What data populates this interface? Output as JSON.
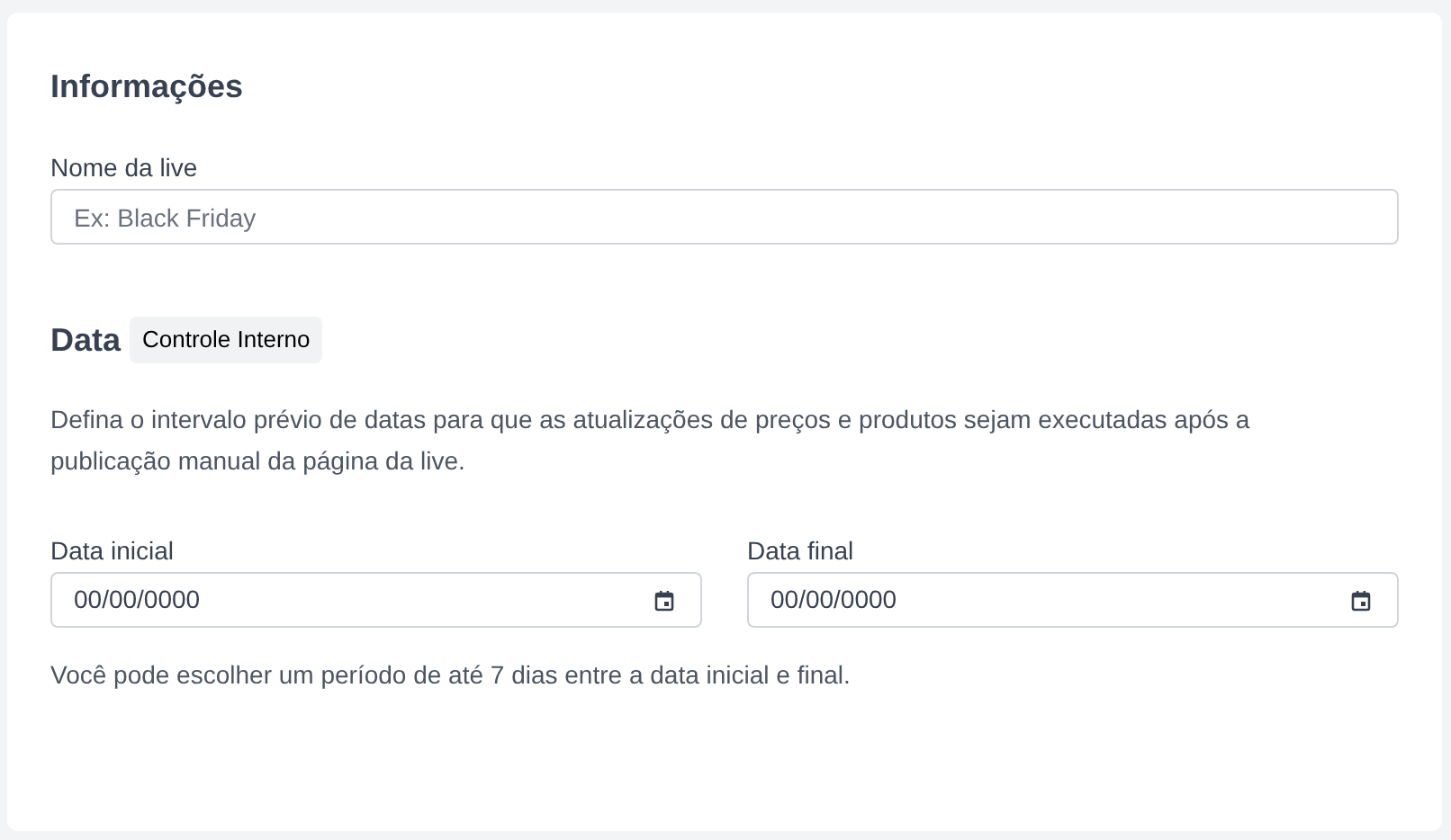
{
  "section_title": "Informações",
  "name_field": {
    "label": "Nome da live",
    "placeholder": "Ex: Black Friday"
  },
  "date_section": {
    "title": "Data",
    "badge": "Controle Interno",
    "description": "Defina o intervalo prévio de datas para que as atualizações de preços e produtos sejam executadas após a publicação manual da página da live.",
    "fields": [
      {
        "label": "Data inicial",
        "value": "00/00/0000"
      },
      {
        "label": "Data final",
        "value": "00/00/0000"
      }
    ],
    "hint": "Você pode escolher um período de até 7 dias entre a data inicial e final."
  }
}
